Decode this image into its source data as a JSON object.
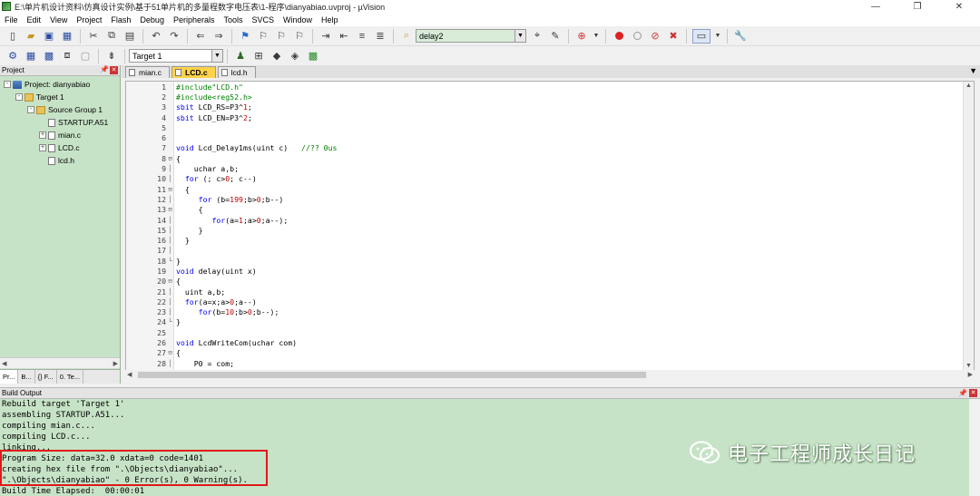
{
  "window": {
    "title": "E:\\单片机设计资料\\仿真设计实例\\基于51单片机的多量程数字电压表\\1-程序\\dianyabiao.uvproj - µVision",
    "minimize": "—",
    "restore": "❐",
    "close": "✕"
  },
  "menu": [
    "File",
    "Edit",
    "View",
    "Project",
    "Flash",
    "Debug",
    "Peripherals",
    "Tools",
    "SVCS",
    "Window",
    "Help"
  ],
  "toolbar": {
    "find_combo_value": "delay2",
    "target_combo_value": "Target 1"
  },
  "project_panel": {
    "title": "Project",
    "tree": [
      {
        "label": "Project: dianyabiao",
        "level": 0,
        "type": "project",
        "expand": "-"
      },
      {
        "label": "Target 1",
        "level": 1,
        "type": "folder",
        "expand": "-"
      },
      {
        "label": "Source Group 1",
        "level": 2,
        "type": "folder",
        "expand": "-"
      },
      {
        "label": "STARTUP.A51",
        "level": 3,
        "type": "file",
        "expand": ""
      },
      {
        "label": "mian.c",
        "level": 3,
        "type": "file",
        "expand": "+"
      },
      {
        "label": "LCD.c",
        "level": 3,
        "type": "file",
        "expand": "+"
      },
      {
        "label": "lcd.h",
        "level": 3,
        "type": "file",
        "expand": ""
      }
    ],
    "tabs": [
      "Pr...",
      "B...",
      "{} F...",
      "0. Te..."
    ]
  },
  "editor": {
    "tabs": [
      {
        "label": "mian.c",
        "active": false
      },
      {
        "label": "LCD.c",
        "active": true
      },
      {
        "label": "lcd.h",
        "active": false
      }
    ],
    "lines": [
      {
        "n": "1",
        "fold": "",
        "html": "<span class='pp'>#include\"LCD.h\"</span>"
      },
      {
        "n": "2",
        "fold": "",
        "html": "<span class='pp'>#include&lt;reg52.h&gt;</span>"
      },
      {
        "n": "3",
        "fold": "",
        "html": "<span class='kw'>sbit</span> LCD_RS=P3^<span class='num'>1</span>;"
      },
      {
        "n": "4",
        "fold": "",
        "html": "<span class='kw'>sbit</span> LCD_EN=P3^<span class='num'>2</span>;"
      },
      {
        "n": "5",
        "fold": "",
        "html": ""
      },
      {
        "n": "6",
        "fold": "",
        "html": ""
      },
      {
        "n": "7",
        "fold": "",
        "html": "<span class='kw'>void</span> Lcd_Delay1ms(uint c)   <span class='cm'>//?? 0us</span>"
      },
      {
        "n": "8",
        "fold": "⊟",
        "html": "{"
      },
      {
        "n": "9",
        "fold": "│",
        "html": "    uchar a,b;"
      },
      {
        "n": "10",
        "fold": "│",
        "html": "  <span class='kw'>for</span> (; c&gt;<span class='num'>0</span>; c--)"
      },
      {
        "n": "11",
        "fold": "⊟",
        "html": "  {"
      },
      {
        "n": "12",
        "fold": "│",
        "html": "     <span class='kw'>for</span> (b=<span class='num'>199</span>;b&gt;<span class='num'>0</span>;b--)"
      },
      {
        "n": "13",
        "fold": "⊟",
        "html": "     {"
      },
      {
        "n": "14",
        "fold": "│",
        "html": "        <span class='kw'>for</span>(a=<span class='num'>1</span>;a&gt;<span class='num'>0</span>;a--);"
      },
      {
        "n": "15",
        "fold": "│",
        "html": "     }"
      },
      {
        "n": "16",
        "fold": "│",
        "html": "  }"
      },
      {
        "n": "17",
        "fold": "│",
        "html": ""
      },
      {
        "n": "18",
        "fold": "└",
        "html": "}"
      },
      {
        "n": "19",
        "fold": "",
        "html": "<span class='kw'>void</span> delay(uint x)"
      },
      {
        "n": "20",
        "fold": "⊟",
        "html": "{"
      },
      {
        "n": "21",
        "fold": "│",
        "html": "  uint a,b;"
      },
      {
        "n": "22",
        "fold": "│",
        "html": "  <span class='kw'>for</span>(a=x;a&gt;<span class='num'>0</span>;a--)"
      },
      {
        "n": "23",
        "fold": "│",
        "html": "     <span class='kw'>for</span>(b=<span class='num'>10</span>;b&gt;<span class='num'>0</span>;b--);"
      },
      {
        "n": "24",
        "fold": "└",
        "html": "}"
      },
      {
        "n": "25",
        "fold": "",
        "html": ""
      },
      {
        "n": "26",
        "fold": "",
        "html": "<span class='kw'>void</span> LcdWriteCom(uchar com)"
      },
      {
        "n": "27",
        "fold": "⊟",
        "html": "{"
      },
      {
        "n": "28",
        "fold": "│",
        "html": "    P0 = com;"
      }
    ]
  },
  "build_output": {
    "title": "Build Output",
    "lines": [
      "Rebuild target 'Target 1'",
      "assembling STARTUP.A51...",
      "compiling mian.c...",
      "compiling LCD.c...",
      "linking...",
      "Program Size: data=32.0 xdata=0 code=1401",
      "creating hex file from \".\\Objects\\dianyabiao\"...",
      "\".\\Objects\\dianyabiao\" - 0 Error(s), 0 Warning(s).",
      "Build Time Elapsed:  00:00:01"
    ]
  },
  "watermark": {
    "text": "电子工程师成长日记"
  }
}
